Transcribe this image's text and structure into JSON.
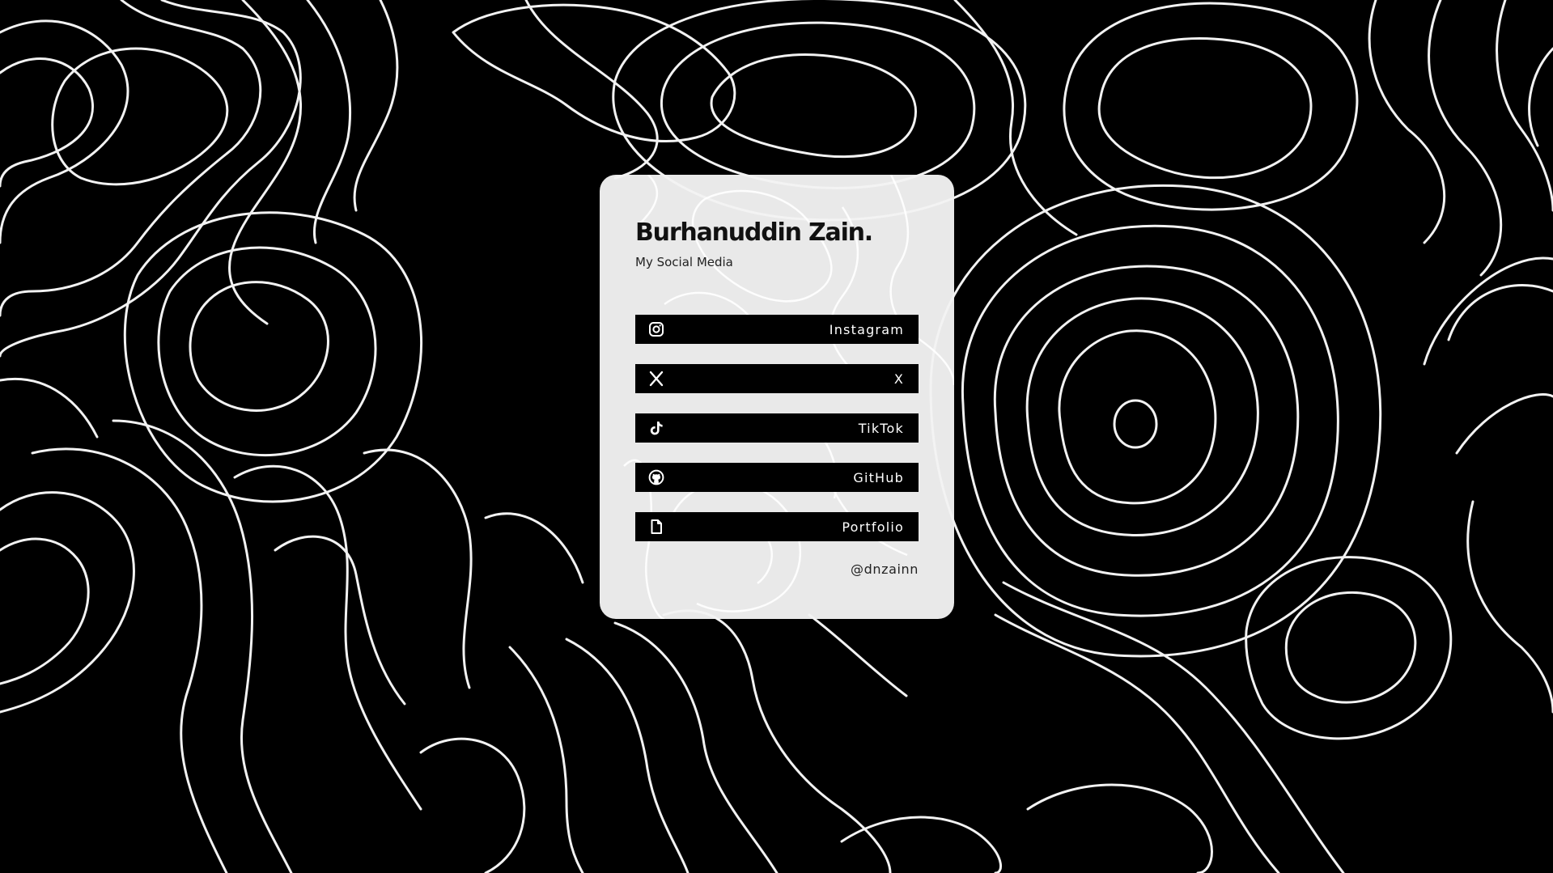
{
  "profile": {
    "name": "Burhanuddin Zain.",
    "subtitle": "My Social Media",
    "handle": "@dnzainn"
  },
  "links": [
    {
      "label": "Instagram",
      "icon": "instagram-icon"
    },
    {
      "label": "X",
      "icon": "x-icon"
    },
    {
      "label": "TikTok",
      "icon": "tiktok-icon"
    },
    {
      "label": "GitHub",
      "icon": "github-icon"
    },
    {
      "label": "Portfolio",
      "icon": "document-icon"
    }
  ],
  "colors": {
    "background": "#000000",
    "contour_lines": "#f2f2f2",
    "card": "#f2f2f2",
    "button": "#000000",
    "button_text": "#ffffff",
    "text": "#111111"
  }
}
